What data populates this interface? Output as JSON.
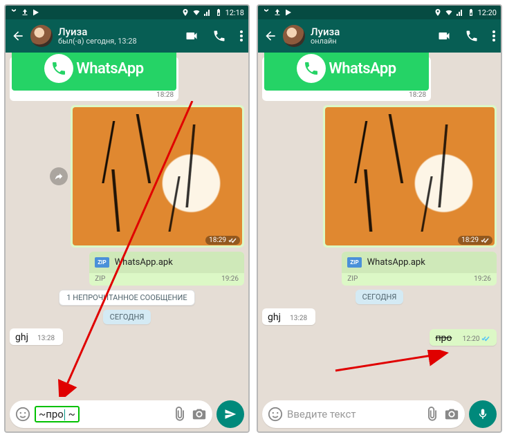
{
  "left": {
    "statusbar_time": "12:18",
    "contact_name": "Луиза",
    "contact_status": "был(-а) сегодня, 13:28",
    "wa_logo_text": "WhatsApp",
    "wa_time": "18:28",
    "tiger_time": "18:29",
    "file_name": "WhatsApp.apk",
    "file_type": "ZIP",
    "file_time": "19:26",
    "unread_pill": "1 НЕПРОЧИТАННОЕ СООБЩЕНИЕ",
    "date_pill": "СЕГОДНЯ",
    "msg_in_text": "ghj",
    "msg_in_time": "13:28",
    "input_text_left": "~про",
    "input_text_right": "~"
  },
  "right": {
    "statusbar_time": "12:20",
    "contact_name": "Луиза",
    "contact_status": "онлайн",
    "wa_logo_text": "WhatsApp",
    "wa_time": "18:28",
    "tiger_time": "18:29",
    "file_name": "WhatsApp.apk",
    "file_type": "ZIP",
    "file_time": "19:26",
    "date_pill": "СЕГОДНЯ",
    "msg_in_text": "ghj",
    "msg_in_time": "13:28",
    "msg_out_text": "про",
    "msg_out_time": "12:20",
    "input_placeholder": "Введите текст"
  }
}
